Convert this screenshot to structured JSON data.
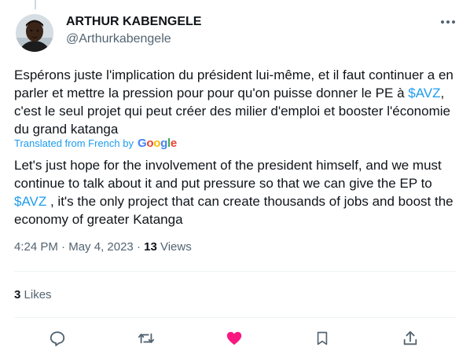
{
  "author": {
    "display_name": "ARTHUR KABENGELE",
    "handle": "@Arthurkabengele"
  },
  "tweet": {
    "original": {
      "part1": "Espérons juste l'implication du président lui-même,  et il faut continuer a en parler et mettre la pression pour pour qu'on puisse donner le PE à ",
      "cashtag": "$AVZ",
      "part2": ",  c'est le seul projet qui peut créer des milier d'emploi et booster l'économie du grand katanga"
    },
    "translated_label": "Translated from French by",
    "translation_provider": "Google",
    "translation": {
      "part1": "Let's just hope for the involvement of the president himself, and we must continue to talk about it and put pressure so that we can give the EP to ",
      "cashtag": "$AVZ",
      "part2": " , it's the only project that can create thousands of jobs and boost the economy of greater Katanga"
    },
    "time": "4:24 PM",
    "separator": "·",
    "date": "May 4, 2023",
    "views_count": "13",
    "views_label": "Views",
    "likes_count": "3",
    "likes_label": "Likes"
  },
  "colors": {
    "accent": "#1d9bf0",
    "like_active": "#f91880",
    "muted": "#536471",
    "text": "#0f1419"
  },
  "icons": {
    "more": "more-horizontal-icon",
    "reply": "reply-icon",
    "retweet": "retweet-icon",
    "like": "heart-icon",
    "bookmark": "bookmark-icon",
    "share": "share-icon"
  }
}
